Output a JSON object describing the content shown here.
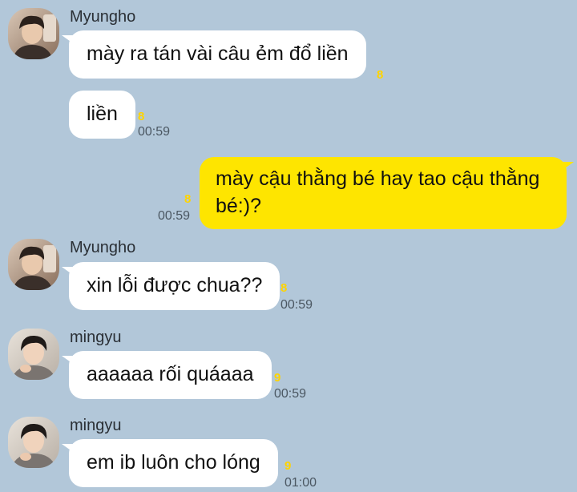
{
  "messages": [
    {
      "sender": "Myungho",
      "text": "mày ra tán vài câu ẻm đổ liền",
      "unread": "8",
      "time": ""
    },
    {
      "sender": "",
      "text": "liền",
      "unread": "8",
      "time": "00:59"
    },
    {
      "sender": "me",
      "text": "mày cậu thằng bé hay tao cậu thằng bé:)?",
      "unread": "8",
      "time": "00:59"
    },
    {
      "sender": "Myungho",
      "text": "xin lỗi được chua??",
      "unread": "8",
      "time": "00:59"
    },
    {
      "sender": "mingyu",
      "text": "aaaaaa rối quáaaa",
      "unread": "9",
      "time": "00:59"
    },
    {
      "sender": "mingyu",
      "text": "em ib luôn cho lóng",
      "unread": "9",
      "time": "01:00"
    }
  ],
  "colors": {
    "background": "#b2c7d9",
    "incoming_bubble": "#ffffff",
    "outgoing_bubble": "#fee500",
    "unread_count": "#ffd400"
  },
  "icons": {
    "myungho_avatar": "profile-photo",
    "mingyu_avatar": "profile-photo"
  }
}
